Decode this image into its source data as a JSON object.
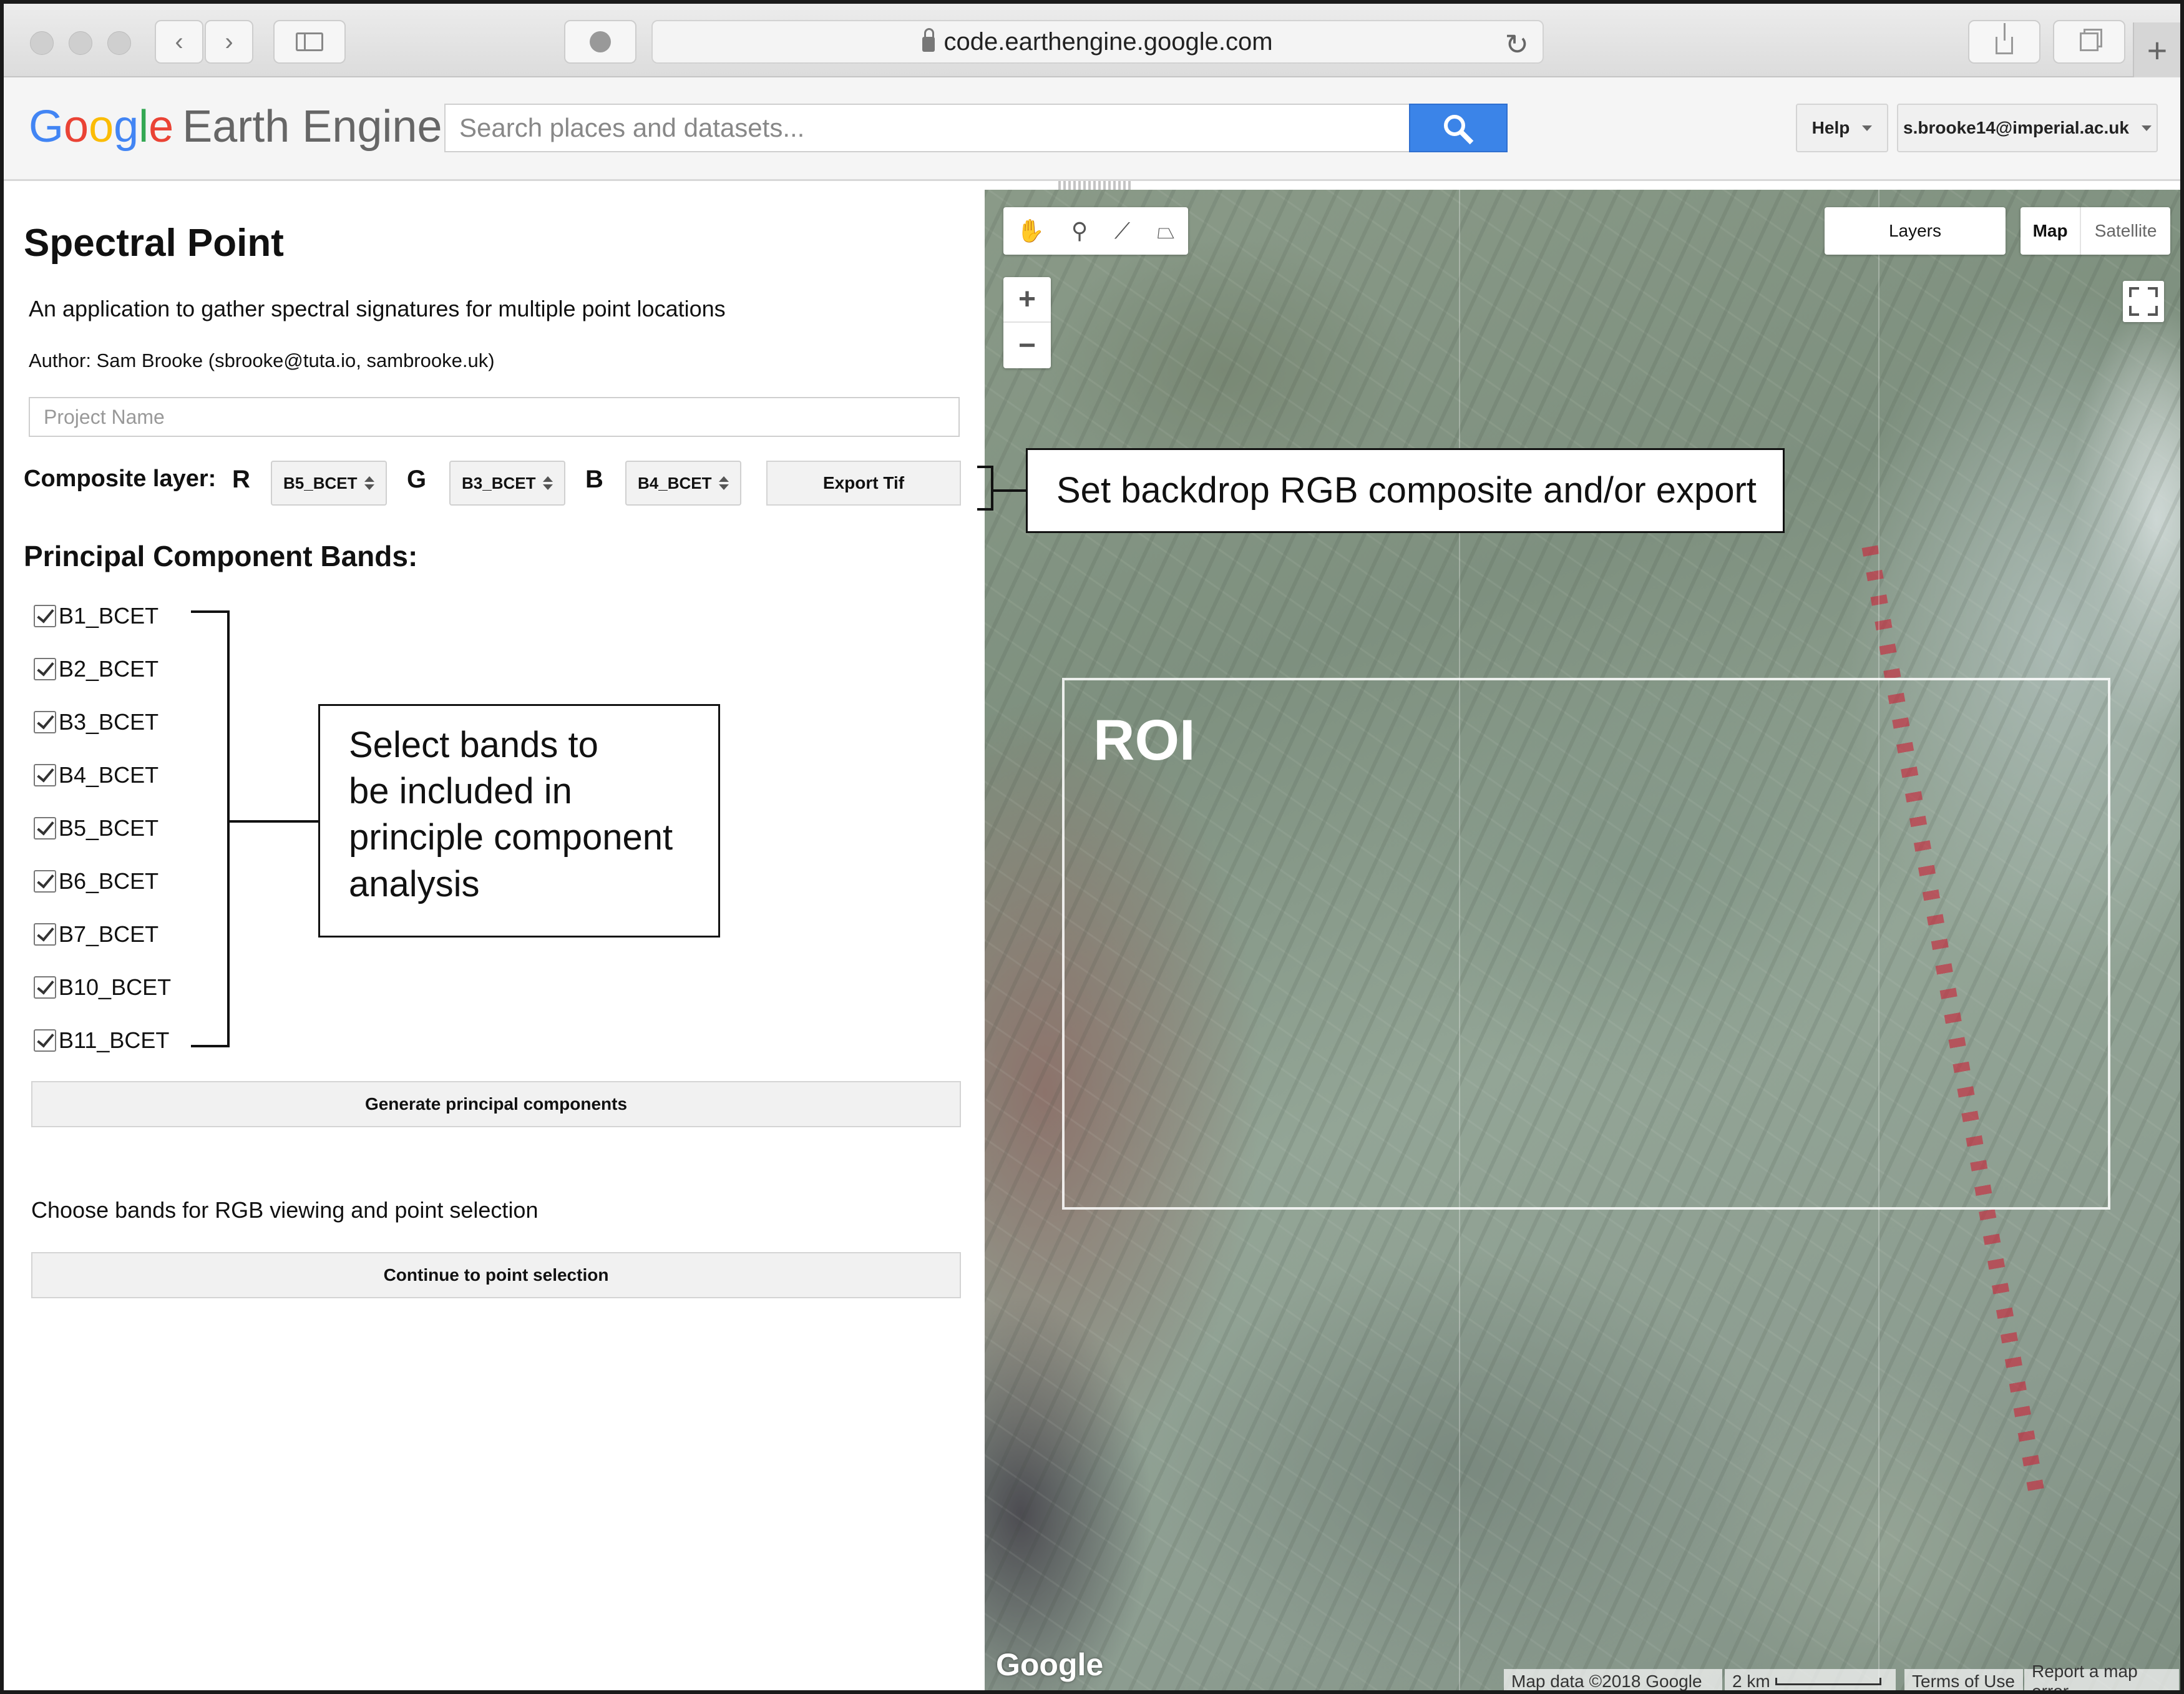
{
  "browser": {
    "url": "code.earthengine.google.com"
  },
  "header": {
    "logo_google": [
      "G",
      "o",
      "o",
      "g",
      "l",
      "e"
    ],
    "logo_product": "Earth Engine",
    "search_placeholder": "Search places and datasets...",
    "help_label": "Help",
    "user_label": "s.brooke14@imperial.ac.uk"
  },
  "panel": {
    "title": "Spectral Point",
    "description": "An application to gather spectral signatures for multiple point locations",
    "author": "Author: Sam Brooke (sbrooke@tuta.io, sambrooke.uk)",
    "project_placeholder": "Project Name",
    "composite_label": "Composite layer:",
    "rgb": [
      {
        "letter": "R",
        "value": "B5_BCET"
      },
      {
        "letter": "G",
        "value": "B3_BCET"
      },
      {
        "letter": "B",
        "value": "B4_BCET"
      }
    ],
    "export_label": "Export Tif",
    "pc_bands_label": "Principal Component Bands:",
    "bands": [
      {
        "label": "B1_BCET",
        "checked": true
      },
      {
        "label": "B2_BCET",
        "checked": true
      },
      {
        "label": "B3_BCET",
        "checked": true
      },
      {
        "label": "B4_BCET",
        "checked": true
      },
      {
        "label": "B5_BCET",
        "checked": true
      },
      {
        "label": "B6_BCET",
        "checked": true
      },
      {
        "label": "B7_BCET",
        "checked": true
      },
      {
        "label": "B10_BCET",
        "checked": true
      },
      {
        "label": "B11_BCET",
        "checked": true
      }
    ],
    "generate_label": "Generate principal components",
    "choose_text": "Choose bands for RGB viewing and point selection",
    "continue_label": "Continue to point selection"
  },
  "annotations": {
    "composite_callout": "Set backdrop RGB composite and/or export",
    "bands_callout": "Select bands to be included in principle component analysis",
    "bands_callout_lines": [
      "Select bands to",
      "be included in",
      "principle component",
      "analysis"
    ]
  },
  "map": {
    "layers_label": "Layers",
    "map_label": "Map",
    "satellite_label": "Satellite",
    "zoom_in": "+",
    "zoom_out": "−",
    "roi_label": "ROI",
    "google_mark": "Google",
    "map_data": "Map data ©2018 Google",
    "scale": "2 km",
    "terms": "Terms of Use",
    "report": "Report a map error"
  },
  "icons": {
    "back": "chevron-left-icon",
    "forward": "chevron-right-icon",
    "sidebar": "sidebar-icon",
    "privacy": "shield-icon",
    "reload": "reload-icon",
    "share": "share-icon",
    "tabs": "tabs-icon",
    "new_tab": "plus-icon",
    "search": "search-icon",
    "hand": "hand-icon",
    "marker": "marker-icon",
    "line": "line-icon",
    "polygon": "polygon-icon",
    "fullscreen": "fullscreen-icon"
  },
  "colors": {
    "search_button": "#3b84e8",
    "google_blue": "#4285f4",
    "google_red": "#ea4335",
    "google_yellow": "#fbbc05",
    "google_green": "#34a853"
  }
}
